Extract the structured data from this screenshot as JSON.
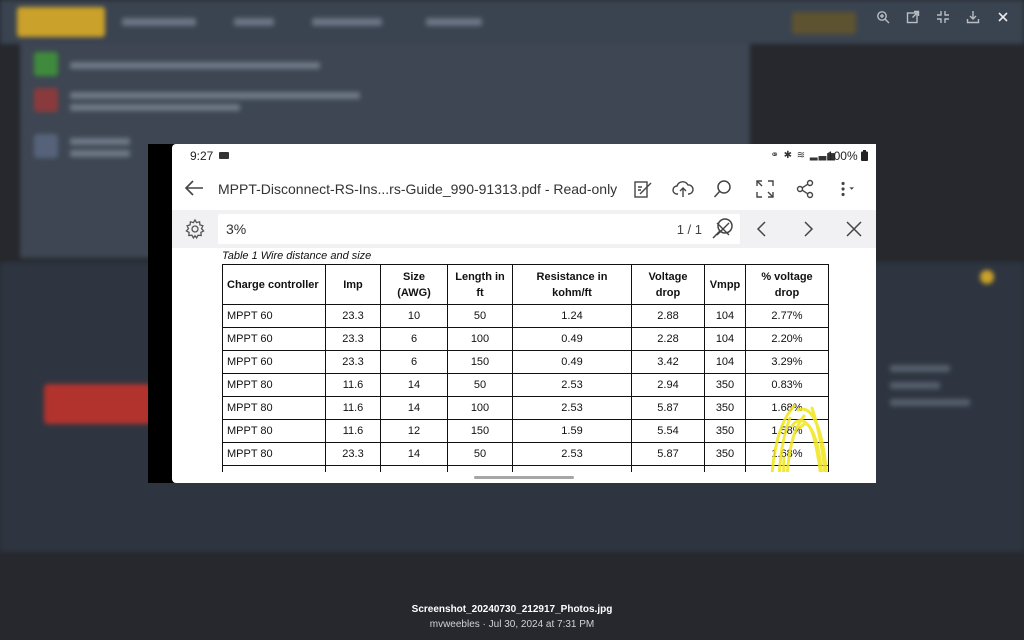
{
  "viewer": {
    "toolbar": [
      {
        "name": "zoom-icon"
      },
      {
        "name": "open-external-icon"
      },
      {
        "name": "collapse-icon"
      },
      {
        "name": "download-icon"
      },
      {
        "name": "close-icon"
      }
    ]
  },
  "phone": {
    "status": {
      "time": "9:27",
      "battery": "100%"
    },
    "app": {
      "title": "MPPT-Disconnect-RS-Ins...rs-Guide_990-91313.pdf - Read-only"
    },
    "search": {
      "query": "3%",
      "count": "1 / 1"
    },
    "document": {
      "caption": "Table 1 Wire distance and size",
      "headers": [
        [
          "Charge controller"
        ],
        [
          "Imp"
        ],
        [
          "Size",
          "(AWG)"
        ],
        [
          "Length in",
          "ft"
        ],
        [
          "Resistance in",
          "kohm/ft"
        ],
        [
          "Voltage",
          "drop"
        ],
        [
          "Vmpp"
        ],
        [
          "% voltage",
          "drop"
        ]
      ],
      "rows": [
        [
          "MPPT 60",
          "23.3",
          "10",
          "50",
          "1.24",
          "2.88",
          "104",
          "2.77%"
        ],
        [
          "MPPT 60",
          "23.3",
          "6",
          "100",
          "0.49",
          "2.28",
          "104",
          "2.20%"
        ],
        [
          "MPPT 60",
          "23.3",
          "6",
          "150",
          "0.49",
          "3.42",
          "104",
          "3.29%"
        ],
        [
          "MPPT 80",
          "11.6",
          "14",
          "50",
          "2.53",
          "2.94",
          "350",
          "0.83%"
        ],
        [
          "MPPT 80",
          "11.6",
          "14",
          "100",
          "2.53",
          "5.87",
          "350",
          "1.68%"
        ],
        [
          "MPPT 80",
          "11.6",
          "12",
          "150",
          "1.59",
          "5.54",
          "350",
          "1.58%"
        ],
        [
          "MPPT 80",
          "23.3",
          "14",
          "50",
          "2.53",
          "5.87",
          "350",
          "1.68%"
        ]
      ]
    }
  },
  "file": {
    "name": "Screenshot_20240730_212917_Photos.jpg",
    "meta": "mvweebles · Jul 30, 2024 at 7:31 PM"
  },
  "colors": {
    "highlighter": "#f2e61a",
    "backdrop": "#26282d"
  }
}
